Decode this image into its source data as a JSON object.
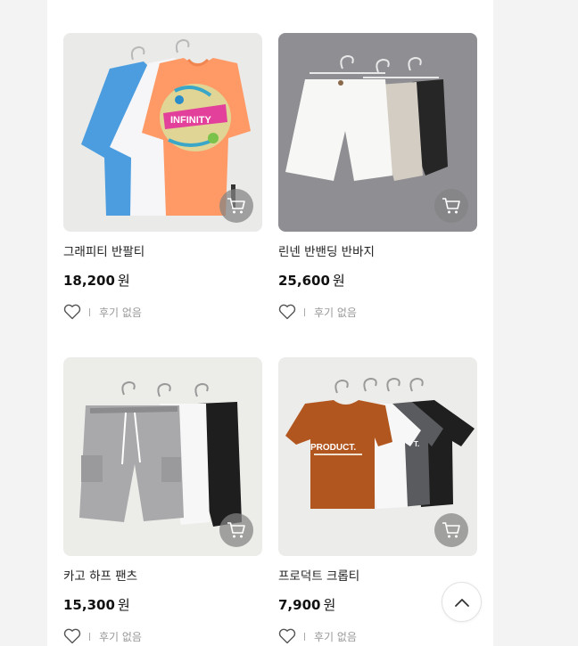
{
  "products": [
    {
      "name": "그래피티 반팔티",
      "price": "18,200",
      "currency": "원",
      "review": "후기 없음",
      "image": "graffiti-tshirts-photo"
    },
    {
      "name": "린넨 반밴딩 반바지",
      "price": "25,600",
      "currency": "원",
      "review": "후기 없음",
      "image": "linen-shorts-photo"
    },
    {
      "name": "카고 하프 팬츠",
      "price": "15,300",
      "currency": "원",
      "review": "후기 없음",
      "image": "cargo-half-pants-photo"
    },
    {
      "name": "프로덕트 크롭티",
      "price": "7,900",
      "currency": "원",
      "review": "후기 없음",
      "image": "product-crop-tee-photo"
    }
  ],
  "icons": {
    "cart": "cart-icon",
    "wishlist": "heart-icon",
    "scroll_top": "chevron-up-icon"
  },
  "colors": {
    "background": "#f3f3f3",
    "panel": "#ffffff",
    "cart_button": "#8a8a8a"
  }
}
